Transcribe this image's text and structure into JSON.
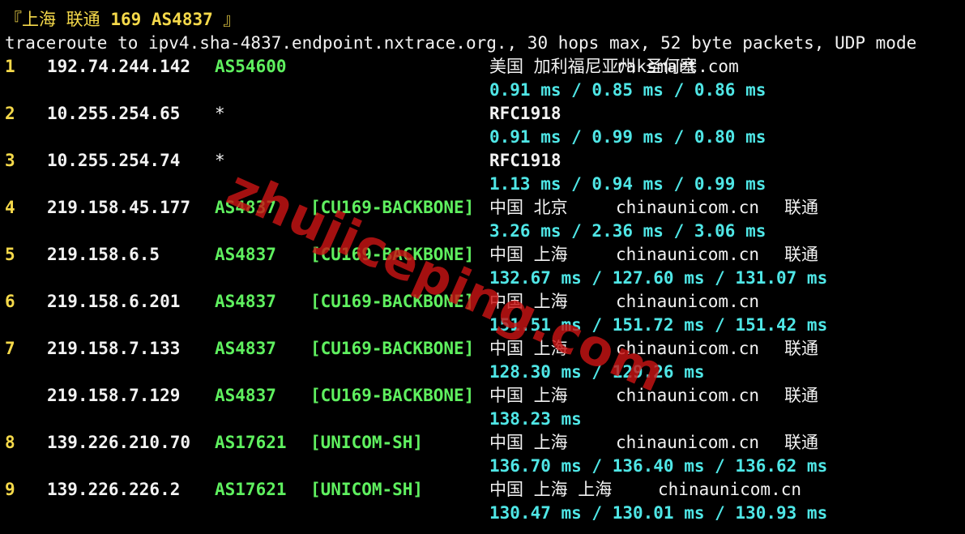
{
  "header": {
    "bracket_open": "『",
    "location": "上海 联通",
    "route_id": "169 AS4837",
    "bracket_close": "』"
  },
  "command_line": "traceroute to ipv4.sha-4837.endpoint.nxtrace.org., 30 hops max, 52 byte packets, UDP mode",
  "hops": [
    {
      "hop": "1",
      "ip": "192.74.244.142",
      "asn": "AS54600",
      "tag": "",
      "geo": "美国 加利福尼亚州 圣何塞",
      "host": "raksmart.com",
      "isp": "",
      "rtt": "0.91 ms / 0.85 ms / 0.86 ms"
    },
    {
      "hop": "2",
      "ip": "10.255.254.65",
      "asn": "*",
      "tag": "",
      "geo": "RFC1918",
      "host": "",
      "isp": "",
      "rtt": "0.91 ms / 0.99 ms / 0.80 ms"
    },
    {
      "hop": "3",
      "ip": "10.255.254.74",
      "asn": "*",
      "tag": "",
      "geo": "RFC1918",
      "host": "",
      "isp": "",
      "rtt": "1.13 ms / 0.94 ms / 0.99 ms"
    },
    {
      "hop": "4",
      "ip": "219.158.45.177",
      "asn": "AS4837",
      "tag": "[CU169-BACKBONE]",
      "geo": "中国 北京",
      "host": "chinaunicom.cn",
      "isp": "联通",
      "rtt": "3.26 ms / 2.36 ms / 3.06 ms"
    },
    {
      "hop": "5",
      "ip": "219.158.6.5",
      "asn": "AS4837",
      "tag": "[CU169-BACKBONE]",
      "geo": "中国 上海",
      "host": "chinaunicom.cn",
      "isp": "联通",
      "rtt": "132.67 ms / 127.60 ms / 131.07 ms"
    },
    {
      "hop": "6",
      "ip": "219.158.6.201",
      "asn": "AS4837",
      "tag": "[CU169-BACKBONE]",
      "geo": "中国 上海",
      "host": "chinaunicom.cn",
      "isp": "",
      "rtt": "151.51 ms / 151.72 ms / 151.42 ms"
    },
    {
      "hop": "7",
      "ip": "219.158.7.133",
      "asn": "AS4837",
      "tag": "[CU169-BACKBONE]",
      "geo": "中国 上海",
      "host": "chinaunicom.cn",
      "isp": "联通",
      "rtt": "128.30 ms / 129.26 ms"
    },
    {
      "hop": "",
      "ip": "219.158.7.129",
      "asn": "AS4837",
      "tag": "[CU169-BACKBONE]",
      "geo": "中国 上海",
      "host": "chinaunicom.cn",
      "isp": "联通",
      "rtt": "138.23 ms"
    },
    {
      "hop": "8",
      "ip": "139.226.210.70",
      "asn": "AS17621",
      "tag": "[UNICOM-SH]",
      "geo": "中国 上海",
      "host": "chinaunicom.cn",
      "isp": "联通",
      "rtt": "136.70 ms / 136.40 ms / 136.62 ms"
    },
    {
      "hop": "9",
      "ip": "139.226.226.2",
      "asn": "AS17621",
      "tag": "[UNICOM-SH]",
      "geo": "中国 上海 上海",
      "host": "chinaunicom.cn",
      "isp": "",
      "rtt": "130.47 ms / 130.01 ms / 130.93 ms"
    }
  ],
  "watermark": "zhujiceping.com",
  "colors": {
    "background": "#000000",
    "hop_number": "#f5d94a",
    "asn": "#5ff05f",
    "rtt": "#4fe6e6",
    "text": "#f2f2f2",
    "watermark": "#c81414"
  }
}
